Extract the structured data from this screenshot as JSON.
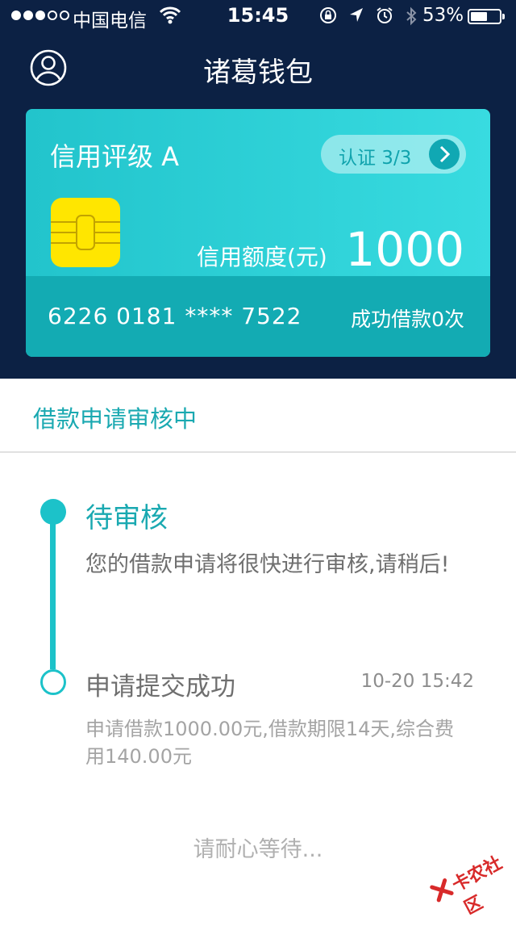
{
  "status_bar": {
    "carrier": "中国电信",
    "time": "15:45",
    "battery": "53%",
    "battery_level": 0.53
  },
  "nav": {
    "title": "诸葛钱包"
  },
  "card": {
    "rating": "信用评级 A",
    "certification": "认证 3/3",
    "limit_label": "信用额度(元)",
    "limit_value": "1000",
    "card_number": "6226 0181 **** 7522",
    "success_count": "成功借款0次"
  },
  "section": {
    "title": "借款申请审核中"
  },
  "timeline": [
    {
      "title": "待审核",
      "desc": "您的借款申请将很快进行审核,请稍后!"
    },
    {
      "title": "申请提交成功",
      "time": "10-20 15:42",
      "desc": "申请借款1000.00元,借款期限14天,综合费用140.00元"
    }
  ],
  "footer": {
    "waiting": "请耐心等待..."
  },
  "watermark": {
    "text": "卡农社区"
  },
  "colors": {
    "header_bg": "#0c2144",
    "accent": "#1aa9b1",
    "card_top": "#2fd1d7",
    "card_bottom": "#13abb3",
    "chip": "#ffe600"
  }
}
